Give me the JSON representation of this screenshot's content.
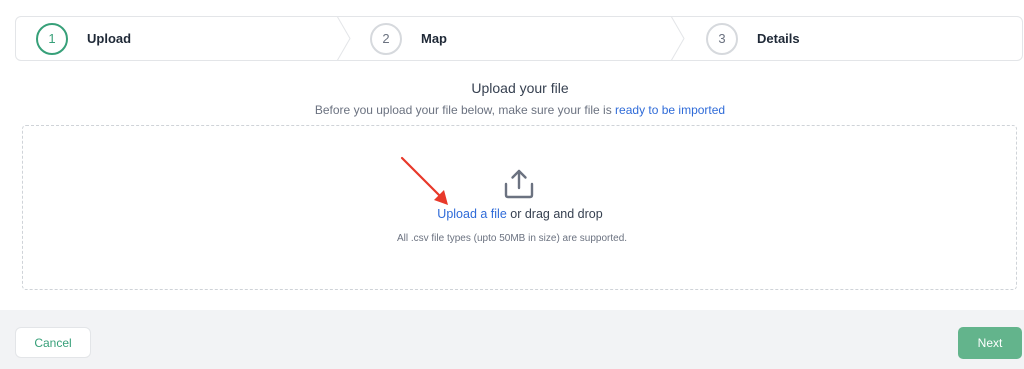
{
  "stepper": {
    "steps": [
      {
        "number": "1",
        "label": "Upload"
      },
      {
        "number": "2",
        "label": "Map"
      },
      {
        "number": "3",
        "label": "Details"
      }
    ],
    "active_index": 0
  },
  "upload": {
    "title": "Upload your file",
    "subtitle_prefix": "Before you upload your file below, make sure your file is ",
    "subtitle_link": "ready to be imported",
    "upload_link": "Upload a file",
    "upload_suffix": " or drag and drop",
    "hint": "All .csv file types (upto 50MB in size) are supported.",
    "icon": "upload-icon"
  },
  "footer": {
    "cancel_label": "Cancel",
    "next_label": "Next"
  },
  "colors": {
    "accent_green": "#37a079",
    "next_button": "#63b48c",
    "link_blue": "#2f6bd8",
    "annotation_arrow": "#e8392a"
  }
}
